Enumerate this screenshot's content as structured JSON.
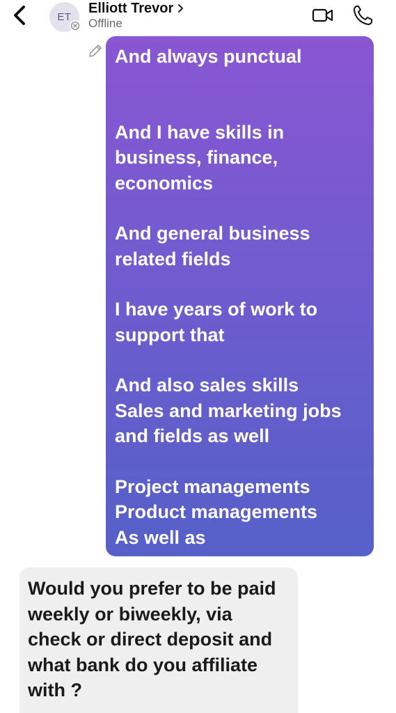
{
  "header": {
    "avatar_initials": "ET",
    "contact_name": "Elliott Trevor",
    "contact_status": "Offline"
  },
  "messages": {
    "outgoing": [
      "And always punctual",
      "And I have skills in business, finance, economics",
      "And general business related fields",
      "I have years of work to support that",
      "And also sales skills",
      "Sales and marketing jobs and fields as well",
      "Project managements",
      "Product managements",
      "As well as"
    ],
    "incoming": [
      "Would you prefer to be paid weekly or biweekly, via check or direct deposit and what bank do you affiliate with ?"
    ]
  },
  "icons": {
    "back": "chevron-left-icon",
    "video": "video-camera-icon",
    "call": "phone-icon",
    "status": "offline-x-icon",
    "edit": "pencil-icon"
  },
  "colors": {
    "bubble_gradient_top": "#8a56d2",
    "bubble_gradient_bottom": "#5560c8",
    "incoming_bubble": "#efefef"
  }
}
